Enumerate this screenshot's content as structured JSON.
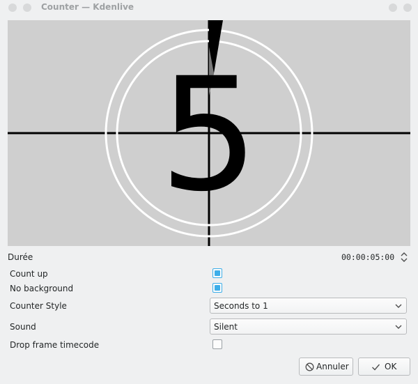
{
  "window": {
    "title": "Counter — Kdenlive"
  },
  "preview": {
    "digit": "5"
  },
  "form": {
    "duration_label": "Durée",
    "duration_value": "00:00:05:00",
    "count_up_label": "Count up",
    "count_up_checked": true,
    "no_background_label": "No background",
    "no_background_checked": true,
    "counter_style_label": "Counter Style",
    "counter_style_value": "Seconds to 1",
    "sound_label": "Sound",
    "sound_value": "Silent",
    "drop_frame_label": "Drop frame timecode",
    "drop_frame_checked": false
  },
  "buttons": {
    "cancel_label": "Annuler",
    "ok_label": "OK"
  },
  "icons": {
    "cancel": "cancel-circle-icon",
    "ok": "checkmark-icon",
    "combo": "chevron-down-icon",
    "spin": "spinbox-arrows-icon"
  },
  "colors": {
    "accent": "#3daee9",
    "window_bg": "#eff0f1",
    "preview_bg": "#cfcfcf"
  }
}
